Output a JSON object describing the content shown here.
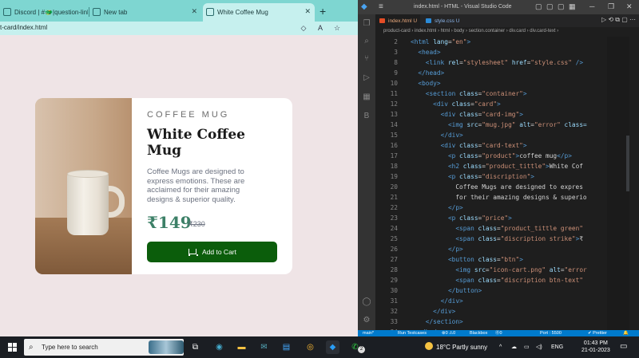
{
  "browser": {
    "tabs": [
      {
        "label": "Discord | #🐲|question-links |"
      },
      {
        "label": "New tab"
      },
      {
        "label": "White Coffee Mug"
      }
    ],
    "url": "t-card/index.html"
  },
  "card": {
    "product": "COFFEE MUG",
    "title": "White Coffee Mug",
    "description": "Coffee Mugs are designed to express emotions. These are acclaimed for their amazing designs & superior quality.",
    "price": "₹149",
    "old_price": "₹230",
    "button": "Add to Cart"
  },
  "vscode": {
    "title": "index.html - HTML - Visual Studio Code",
    "tabs": [
      {
        "label": "index.html U"
      },
      {
        "label": "style.css U"
      }
    ],
    "breadcrumb": "product-card › index.html › html › body › section.container › div.card › div.card-text ›",
    "lines": [
      {
        "n": "2",
        "html": "<span class='tg'>&lt;html</span> <span class='at'>lang</span>=<span class='st'>\"en\"</span><span class='tg'>&gt;</span>"
      },
      {
        "n": "3",
        "html": "  <span class='tg'>&lt;head&gt;</span>"
      },
      {
        "n": "8",
        "html": "    <span class='tg'>&lt;link</span> <span class='at'>rel</span>=<span class='st'>\"stylesheet\"</span> <span class='at'>href</span>=<span class='st'>\"style.css\"</span> <span class='tg'>/&gt;</span>"
      },
      {
        "n": "9",
        "html": "  <span class='tg'>&lt;/head&gt;</span>"
      },
      {
        "n": "10",
        "html": "  <span class='tg'>&lt;body&gt;</span>"
      },
      {
        "n": "11",
        "html": "    <span class='tg'>&lt;section</span> <span class='at'>class</span>=<span class='st'>\"container\"</span><span class='tg'>&gt;</span>"
      },
      {
        "n": "12",
        "html": "      <span class='tg'>&lt;div</span> <span class='at'>class</span>=<span class='st'>\"card\"</span><span class='tg'>&gt;</span>"
      },
      {
        "n": "13",
        "html": "        <span class='tg'>&lt;div</span> <span class='at'>class</span>=<span class='st'>\"card-img\"</span><span class='tg'>&gt;</span>"
      },
      {
        "n": "14",
        "html": "          <span class='tg'>&lt;img</span> <span class='at'>src</span>=<span class='st'>\"mug.jpg\"</span> <span class='at'>alt</span>=<span class='st'>\"error\"</span> <span class='at'>class=</span>"
      },
      {
        "n": "15",
        "html": "        <span class='tg'>&lt;/div&gt;</span>"
      },
      {
        "n": "16",
        "html": "        <span class='tg'>&lt;div</span> <span class='at'>class</span>=<span class='st'>\"card-text\"</span><span class='tg'>&gt;</span>"
      },
      {
        "n": "17",
        "html": "          <span class='tg'>&lt;p</span> <span class='at'>class</span>=<span class='st'>\"product\"</span><span class='tg'>&gt;</span>coffee mug<span class='tg'>&lt;/p&gt;</span>"
      },
      {
        "n": "18",
        "html": "          <span class='tg'>&lt;h2</span> <span class='at'>class</span>=<span class='st'>\"product_tittle\"</span><span class='tg'>&gt;</span>White Cof"
      },
      {
        "n": "19",
        "html": "          <span class='tg'>&lt;p</span> <span class='at'>class</span>=<span class='st'>\"discription\"</span><span class='tg'>&gt;</span>"
      },
      {
        "n": "20",
        "html": "            Coffee Mugs are designed to expres"
      },
      {
        "n": "21",
        "html": "            for their amazing designs &amp; superio"
      },
      {
        "n": "22",
        "html": "          <span class='tg'>&lt;/p&gt;</span>"
      },
      {
        "n": "23",
        "html": "          <span class='tg'>&lt;p</span> <span class='at'>class</span>=<span class='st'>\"price\"</span><span class='tg'>&gt;</span>"
      },
      {
        "n": "24",
        "html": "            <span class='tg'>&lt;span</span> <span class='at'>class</span>=<span class='st'>\"product_tittle green\"</span>"
      },
      {
        "n": "25",
        "html": "            <span class='tg'>&lt;span</span> <span class='at'>class</span>=<span class='st'>\"discription strike\"</span><span class='tg'>&gt;</span>₹"
      },
      {
        "n": "26",
        "html": "          <span class='tg'>&lt;/p&gt;</span>"
      },
      {
        "n": "27",
        "html": "          <span class='tg'>&lt;button</span> <span class='at'>class</span>=<span class='st'>\"btn\"</span><span class='tg'>&gt;</span>"
      },
      {
        "n": "28",
        "html": "            <span class='tg'>&lt;img</span> <span class='at'>src</span>=<span class='st'>\"icon-cart.png\"</span> <span class='at'>alt</span>=<span class='st'>\"error</span>"
      },
      {
        "n": "29",
        "html": "            <span class='tg'>&lt;span</span> <span class='at'>class</span>=<span class='st'>\"discription btn-text\"</span>"
      },
      {
        "n": "30",
        "html": "          <span class='tg'>&lt;/button&gt;</span>"
      },
      {
        "n": "31",
        "html": "        <span class='tg'>&lt;/div&gt;</span>"
      },
      {
        "n": "32",
        "html": "      <span class='tg'>&lt;/div&gt;</span>"
      },
      {
        "n": "33",
        "html": "    <span class='tg'>&lt;/section&gt;</span>"
      },
      {
        "n": "34",
        "html": "  <span class='tg'>&lt;/body&gt;</span>"
      }
    ],
    "status": {
      "branch": "main*",
      "testcases": "Run Testcases",
      "problems": "⊗0 ⚠0",
      "blackbox": "Blackbox",
      "info": "⓪0",
      "port": "Port : 5500",
      "prettier": "✔ Prettier"
    }
  },
  "taskbar": {
    "search_placeholder": "Type here to search",
    "weather": "18°C  Partly sunny",
    "lang": "ENG",
    "time": "01:43 PM",
    "date": "21-01-2023",
    "whatsapp_badge": "2"
  },
  "colors": {
    "browser_tab_bg": "#7ed6d1",
    "page_bg": "#efe4e6",
    "price_green": "#3c8067",
    "button_green": "#0b5d0b",
    "vscode_status": "#007acc"
  }
}
